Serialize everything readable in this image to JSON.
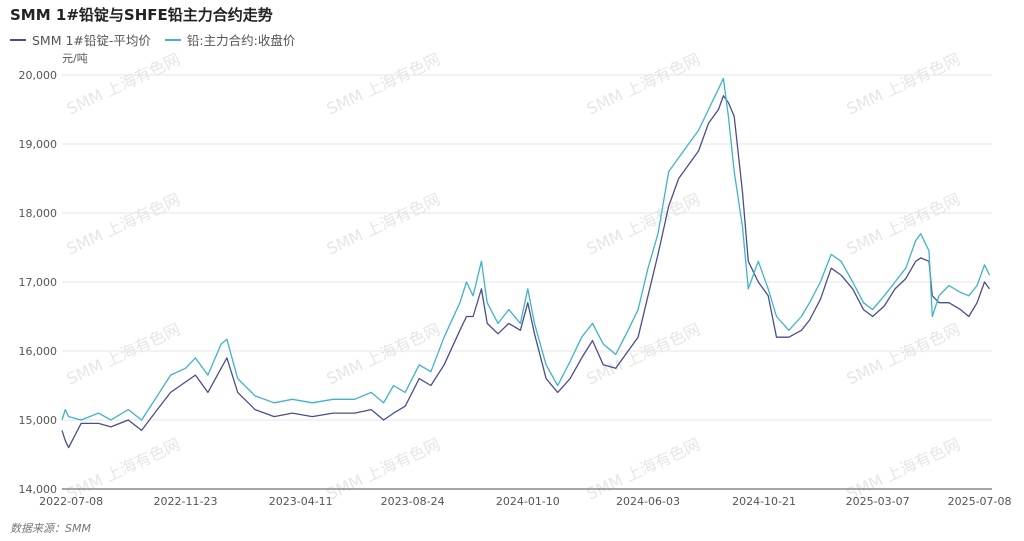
{
  "title": "SMM 1#铅锭与SHFE铅主力合约走势",
  "unit": "元/吨",
  "source": "数据来源：SMM",
  "watermark": "SMM 上海有色网",
  "chart_data": {
    "type": "line",
    "title": "SMM 1#铅锭与SHFE铅主力合约走势",
    "ylabel": "元/吨",
    "ylim": [
      14000,
      20000
    ],
    "yticks": [
      14000,
      15000,
      16000,
      17000,
      18000,
      19000,
      20000
    ],
    "ytick_labels": [
      "14,000",
      "15,000",
      "16,000",
      "17,000",
      "18,000",
      "19,000",
      "20,000"
    ],
    "xlim": [
      "2022-06-27",
      "2025-07-23"
    ],
    "xticks": [
      "2022-07-08",
      "2022-11-23",
      "2023-04-11",
      "2023-08-24",
      "2024-01-10",
      "2024-06-03",
      "2024-10-21",
      "2025-03-07",
      "2025-07-08"
    ],
    "grid": true,
    "legend_position": "top-left",
    "x": [
      "2022-06-27",
      "2022-07-01",
      "2022-07-05",
      "2022-07-20",
      "2022-08-10",
      "2022-08-25",
      "2022-09-15",
      "2022-10-01",
      "2022-10-20",
      "2022-11-05",
      "2022-11-23",
      "2022-12-05",
      "2022-12-20",
      "2023-01-05",
      "2023-01-12",
      "2023-01-25",
      "2023-02-15",
      "2023-03-10",
      "2023-04-01",
      "2023-04-25",
      "2023-05-20",
      "2023-06-15",
      "2023-07-05",
      "2023-07-20",
      "2023-08-01",
      "2023-08-15",
      "2023-09-01",
      "2023-09-15",
      "2023-10-01",
      "2023-10-20",
      "2023-10-28",
      "2023-11-05",
      "2023-11-15",
      "2023-11-22",
      "2023-12-05",
      "2023-12-18",
      "2024-01-01",
      "2024-01-10",
      "2024-01-18",
      "2024-02-01",
      "2024-02-15",
      "2024-03-01",
      "2024-03-15",
      "2024-03-28",
      "2024-04-10",
      "2024-04-25",
      "2024-05-10",
      "2024-05-22",
      "2024-06-03",
      "2024-06-15",
      "2024-06-28",
      "2024-07-10",
      "2024-07-22",
      "2024-08-03",
      "2024-08-15",
      "2024-08-27",
      "2024-09-02",
      "2024-09-08",
      "2024-09-15",
      "2024-09-25",
      "2024-10-02",
      "2024-10-14",
      "2024-10-26",
      "2024-11-05",
      "2024-11-20",
      "2024-12-05",
      "2024-12-15",
      "2024-12-28",
      "2025-01-10",
      "2025-01-22",
      "2025-02-05",
      "2025-02-18",
      "2025-03-01",
      "2025-03-15",
      "2025-03-28",
      "2025-04-10",
      "2025-04-22",
      "2025-04-28",
      "2025-05-08",
      "2025-05-12",
      "2025-05-20",
      "2025-06-01",
      "2025-06-15",
      "2025-06-25",
      "2025-07-05",
      "2025-07-14",
      "2025-07-20"
    ],
    "series": [
      {
        "name": "SMM 1#铅锭-平均价",
        "color": "#4b4e8c",
        "values": [
          14850,
          14700,
          14600,
          14950,
          14950,
          14900,
          15000,
          14850,
          15150,
          15400,
          15550,
          15650,
          15400,
          15750,
          15900,
          15400,
          15150,
          15050,
          15100,
          15050,
          15100,
          15100,
          15150,
          15000,
          15100,
          15200,
          15600,
          15500,
          15800,
          16300,
          16500,
          16500,
          16900,
          16400,
          16250,
          16400,
          16300,
          16700,
          16250,
          15600,
          15400,
          15600,
          15900,
          16150,
          15800,
          15750,
          16000,
          16200,
          16800,
          17400,
          18100,
          18500,
          18700,
          18900,
          19300,
          19500,
          19700,
          19600,
          19400,
          18300,
          17300,
          17000,
          16800,
          16200,
          16200,
          16300,
          16450,
          16750,
          17200,
          17100,
          16900,
          16600,
          16500,
          16650,
          16900,
          17050,
          17300,
          17350,
          17300,
          16800,
          16700,
          16700,
          16600,
          16500,
          16700,
          17000,
          16900
        ]
      },
      {
        "name": "铅:主力合约:收盘价",
        "color": "#3fb3c9",
        "values": [
          15000,
          15150,
          15050,
          15000,
          15100,
          15000,
          15150,
          15000,
          15350,
          15650,
          15750,
          15900,
          15650,
          16100,
          16170,
          15600,
          15350,
          15250,
          15300,
          15250,
          15300,
          15300,
          15400,
          15250,
          15500,
          15400,
          15800,
          15700,
          16200,
          16700,
          17000,
          16800,
          17300,
          16700,
          16400,
          16600,
          16400,
          16900,
          16400,
          15800,
          15500,
          15850,
          16200,
          16400,
          16100,
          15950,
          16300,
          16600,
          17200,
          17700,
          18600,
          18800,
          19000,
          19200,
          19500,
          19800,
          19950,
          19400,
          18600,
          17800,
          16900,
          17300,
          16900,
          16500,
          16300,
          16500,
          16700,
          17000,
          17400,
          17300,
          17000,
          16700,
          16600,
          16800,
          17000,
          17200,
          17600,
          17700,
          17450,
          16500,
          16800,
          16950,
          16850,
          16800,
          16950,
          17250,
          17100
        ]
      }
    ]
  }
}
